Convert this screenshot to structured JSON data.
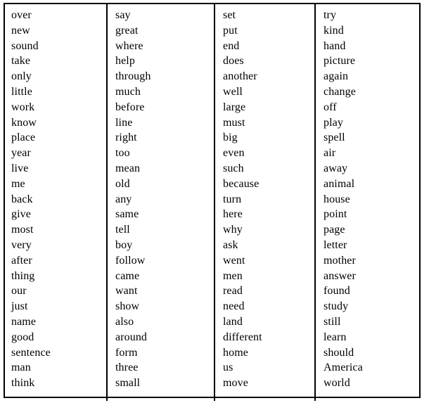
{
  "document": {
    "kind": "word-list-table",
    "background_color": "#ffffff",
    "text_color": "#000000",
    "border_color": "#000000",
    "column_count": 4,
    "row_count": 25
  },
  "columns": [
    {
      "name": "column-1",
      "words": [
        "over",
        "new",
        "sound",
        "take",
        "only",
        "little",
        "work",
        "know",
        "place",
        "year",
        "live",
        "me",
        "back",
        "give",
        "most",
        "very",
        "after",
        "thing",
        "our",
        "just",
        "name",
        "good",
        "sentence",
        "man",
        "think"
      ]
    },
    {
      "name": "column-2",
      "words": [
        "say",
        "great",
        "where",
        "help",
        "through",
        "much",
        "before",
        "line",
        "right",
        "too",
        "mean",
        "old",
        "any",
        "same",
        "tell",
        "boy",
        "follow",
        "came",
        "want",
        "show",
        "also",
        "around",
        "form",
        "three",
        "small"
      ]
    },
    {
      "name": "column-3",
      "words": [
        "set",
        "put",
        "end",
        "does",
        "another",
        "well",
        "large",
        "must",
        "big",
        "even",
        "such",
        "because",
        "turn",
        "here",
        "why",
        "ask",
        "went",
        "men",
        "read",
        "need",
        "land",
        "different",
        "home",
        "us",
        "move"
      ]
    },
    {
      "name": "column-4",
      "words": [
        "try",
        "kind",
        "hand",
        "picture",
        "again",
        "change",
        "off",
        "play",
        "spell",
        "air",
        "away",
        "animal",
        "house",
        "point",
        "page",
        "letter",
        "mother",
        "answer",
        "found",
        "study",
        "still",
        "learn",
        "should",
        "America",
        "world"
      ]
    }
  ]
}
